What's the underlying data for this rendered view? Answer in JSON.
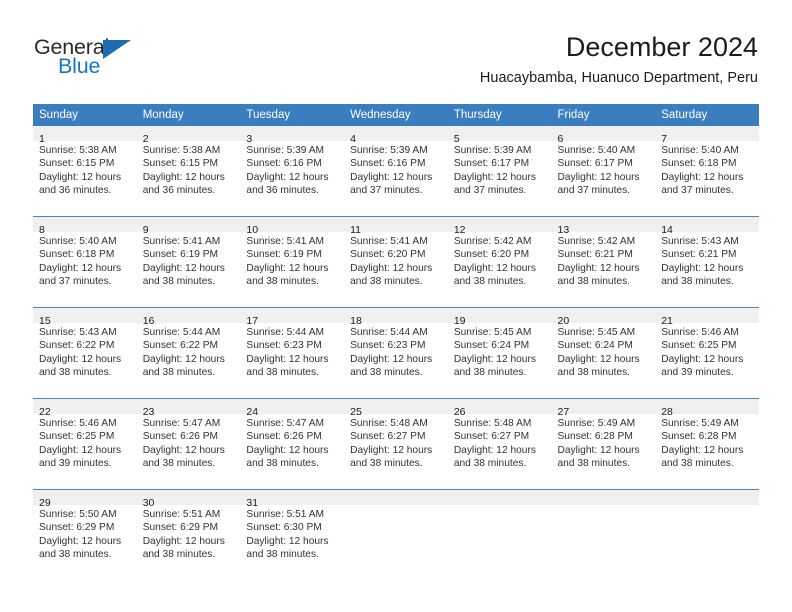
{
  "brand": {
    "name_dark": "General",
    "name_blue": "Blue",
    "accent_color": "#1b75bb",
    "triangle_color": "#1b6cb0"
  },
  "header": {
    "title": "December 2024",
    "subtitle": "Huacaybamba, Huanuco Department, Peru",
    "header_bg_color": "#3a7ebf",
    "header_text_color": "#ffffff",
    "daynum_band_color": "#f0f0f0"
  },
  "weekday_headers": [
    "Sunday",
    "Monday",
    "Tuesday",
    "Wednesday",
    "Thursday",
    "Friday",
    "Saturday"
  ],
  "weeks": [
    [
      {
        "day": "1",
        "sunrise": "Sunrise: 5:38 AM",
        "sunset": "Sunset: 6:15 PM",
        "daylight1": "Daylight: 12 hours",
        "daylight2": "and 36 minutes."
      },
      {
        "day": "2",
        "sunrise": "Sunrise: 5:38 AM",
        "sunset": "Sunset: 6:15 PM",
        "daylight1": "Daylight: 12 hours",
        "daylight2": "and 36 minutes."
      },
      {
        "day": "3",
        "sunrise": "Sunrise: 5:39 AM",
        "sunset": "Sunset: 6:16 PM",
        "daylight1": "Daylight: 12 hours",
        "daylight2": "and 36 minutes."
      },
      {
        "day": "4",
        "sunrise": "Sunrise: 5:39 AM",
        "sunset": "Sunset: 6:16 PM",
        "daylight1": "Daylight: 12 hours",
        "daylight2": "and 37 minutes."
      },
      {
        "day": "5",
        "sunrise": "Sunrise: 5:39 AM",
        "sunset": "Sunset: 6:17 PM",
        "daylight1": "Daylight: 12 hours",
        "daylight2": "and 37 minutes."
      },
      {
        "day": "6",
        "sunrise": "Sunrise: 5:40 AM",
        "sunset": "Sunset: 6:17 PM",
        "daylight1": "Daylight: 12 hours",
        "daylight2": "and 37 minutes."
      },
      {
        "day": "7",
        "sunrise": "Sunrise: 5:40 AM",
        "sunset": "Sunset: 6:18 PM",
        "daylight1": "Daylight: 12 hours",
        "daylight2": "and 37 minutes."
      }
    ],
    [
      {
        "day": "8",
        "sunrise": "Sunrise: 5:40 AM",
        "sunset": "Sunset: 6:18 PM",
        "daylight1": "Daylight: 12 hours",
        "daylight2": "and 37 minutes."
      },
      {
        "day": "9",
        "sunrise": "Sunrise: 5:41 AM",
        "sunset": "Sunset: 6:19 PM",
        "daylight1": "Daylight: 12 hours",
        "daylight2": "and 38 minutes."
      },
      {
        "day": "10",
        "sunrise": "Sunrise: 5:41 AM",
        "sunset": "Sunset: 6:19 PM",
        "daylight1": "Daylight: 12 hours",
        "daylight2": "and 38 minutes."
      },
      {
        "day": "11",
        "sunrise": "Sunrise: 5:41 AM",
        "sunset": "Sunset: 6:20 PM",
        "daylight1": "Daylight: 12 hours",
        "daylight2": "and 38 minutes."
      },
      {
        "day": "12",
        "sunrise": "Sunrise: 5:42 AM",
        "sunset": "Sunset: 6:20 PM",
        "daylight1": "Daylight: 12 hours",
        "daylight2": "and 38 minutes."
      },
      {
        "day": "13",
        "sunrise": "Sunrise: 5:42 AM",
        "sunset": "Sunset: 6:21 PM",
        "daylight1": "Daylight: 12 hours",
        "daylight2": "and 38 minutes."
      },
      {
        "day": "14",
        "sunrise": "Sunrise: 5:43 AM",
        "sunset": "Sunset: 6:21 PM",
        "daylight1": "Daylight: 12 hours",
        "daylight2": "and 38 minutes."
      }
    ],
    [
      {
        "day": "15",
        "sunrise": "Sunrise: 5:43 AM",
        "sunset": "Sunset: 6:22 PM",
        "daylight1": "Daylight: 12 hours",
        "daylight2": "and 38 minutes."
      },
      {
        "day": "16",
        "sunrise": "Sunrise: 5:44 AM",
        "sunset": "Sunset: 6:22 PM",
        "daylight1": "Daylight: 12 hours",
        "daylight2": "and 38 minutes."
      },
      {
        "day": "17",
        "sunrise": "Sunrise: 5:44 AM",
        "sunset": "Sunset: 6:23 PM",
        "daylight1": "Daylight: 12 hours",
        "daylight2": "and 38 minutes."
      },
      {
        "day": "18",
        "sunrise": "Sunrise: 5:44 AM",
        "sunset": "Sunset: 6:23 PM",
        "daylight1": "Daylight: 12 hours",
        "daylight2": "and 38 minutes."
      },
      {
        "day": "19",
        "sunrise": "Sunrise: 5:45 AM",
        "sunset": "Sunset: 6:24 PM",
        "daylight1": "Daylight: 12 hours",
        "daylight2": "and 38 minutes."
      },
      {
        "day": "20",
        "sunrise": "Sunrise: 5:45 AM",
        "sunset": "Sunset: 6:24 PM",
        "daylight1": "Daylight: 12 hours",
        "daylight2": "and 38 minutes."
      },
      {
        "day": "21",
        "sunrise": "Sunrise: 5:46 AM",
        "sunset": "Sunset: 6:25 PM",
        "daylight1": "Daylight: 12 hours",
        "daylight2": "and 39 minutes."
      }
    ],
    [
      {
        "day": "22",
        "sunrise": "Sunrise: 5:46 AM",
        "sunset": "Sunset: 6:25 PM",
        "daylight1": "Daylight: 12 hours",
        "daylight2": "and 39 minutes."
      },
      {
        "day": "23",
        "sunrise": "Sunrise: 5:47 AM",
        "sunset": "Sunset: 6:26 PM",
        "daylight1": "Daylight: 12 hours",
        "daylight2": "and 38 minutes."
      },
      {
        "day": "24",
        "sunrise": "Sunrise: 5:47 AM",
        "sunset": "Sunset: 6:26 PM",
        "daylight1": "Daylight: 12 hours",
        "daylight2": "and 38 minutes."
      },
      {
        "day": "25",
        "sunrise": "Sunrise: 5:48 AM",
        "sunset": "Sunset: 6:27 PM",
        "daylight1": "Daylight: 12 hours",
        "daylight2": "and 38 minutes."
      },
      {
        "day": "26",
        "sunrise": "Sunrise: 5:48 AM",
        "sunset": "Sunset: 6:27 PM",
        "daylight1": "Daylight: 12 hours",
        "daylight2": "and 38 minutes."
      },
      {
        "day": "27",
        "sunrise": "Sunrise: 5:49 AM",
        "sunset": "Sunset: 6:28 PM",
        "daylight1": "Daylight: 12 hours",
        "daylight2": "and 38 minutes."
      },
      {
        "day": "28",
        "sunrise": "Sunrise: 5:49 AM",
        "sunset": "Sunset: 6:28 PM",
        "daylight1": "Daylight: 12 hours",
        "daylight2": "and 38 minutes."
      }
    ],
    [
      {
        "day": "29",
        "sunrise": "Sunrise: 5:50 AM",
        "sunset": "Sunset: 6:29 PM",
        "daylight1": "Daylight: 12 hours",
        "daylight2": "and 38 minutes."
      },
      {
        "day": "30",
        "sunrise": "Sunrise: 5:51 AM",
        "sunset": "Sunset: 6:29 PM",
        "daylight1": "Daylight: 12 hours",
        "daylight2": "and 38 minutes."
      },
      {
        "day": "31",
        "sunrise": "Sunrise: 5:51 AM",
        "sunset": "Sunset: 6:30 PM",
        "daylight1": "Daylight: 12 hours",
        "daylight2": "and 38 minutes."
      },
      {
        "day": "",
        "sunrise": "",
        "sunset": "",
        "daylight1": "",
        "daylight2": ""
      },
      {
        "day": "",
        "sunrise": "",
        "sunset": "",
        "daylight1": "",
        "daylight2": ""
      },
      {
        "day": "",
        "sunrise": "",
        "sunset": "",
        "daylight1": "",
        "daylight2": ""
      },
      {
        "day": "",
        "sunrise": "",
        "sunset": "",
        "daylight1": "",
        "daylight2": ""
      }
    ]
  ]
}
